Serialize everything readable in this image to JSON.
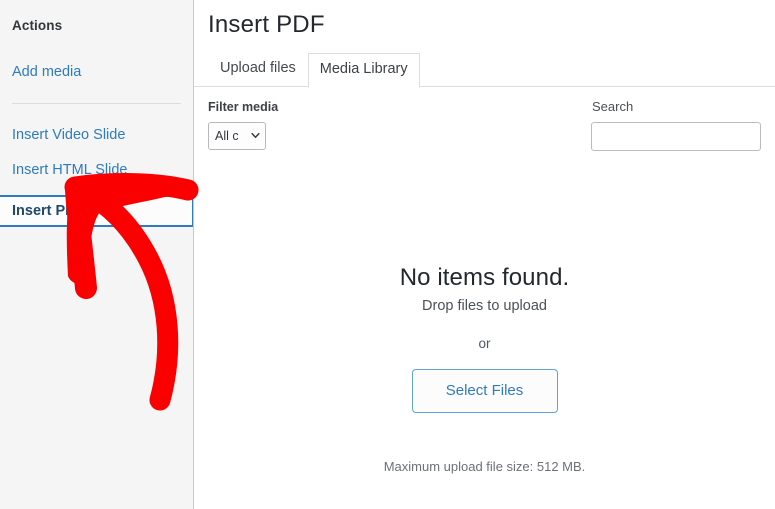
{
  "sidebar": {
    "heading": "Actions",
    "add_media_label": "Add media",
    "items": [
      {
        "label": "Insert Video Slide"
      },
      {
        "label": "Insert HTML Slide"
      },
      {
        "label": "Insert PDF"
      }
    ],
    "selected_label": "Insert PDF"
  },
  "main": {
    "title": "Insert PDF",
    "tabs": [
      {
        "label": "Upload files",
        "active": false
      },
      {
        "label": "Media Library",
        "active": true
      }
    ],
    "filter": {
      "label": "Filter media",
      "selected_option": "All c",
      "options": [
        "All c"
      ]
    },
    "search": {
      "label": "Search",
      "value": "",
      "placeholder": ""
    },
    "empty_state": {
      "title": "No items found.",
      "subtitle": "Drop files to upload",
      "or_text": "or",
      "select_files_label": "Select Files"
    },
    "max_upload_text": "Maximum upload file size: 512 MB."
  },
  "annotation": {
    "type": "hand-drawn-arrow",
    "color": "#fa0000",
    "points_to": "Insert PDF"
  },
  "colors": {
    "link_blue": "#2f7bbf",
    "accent_blue": "#2f7bbf",
    "sidebar_bg": "#f4f5f4",
    "text_dark": "#23282d",
    "annotation_red": "#fa0000"
  }
}
